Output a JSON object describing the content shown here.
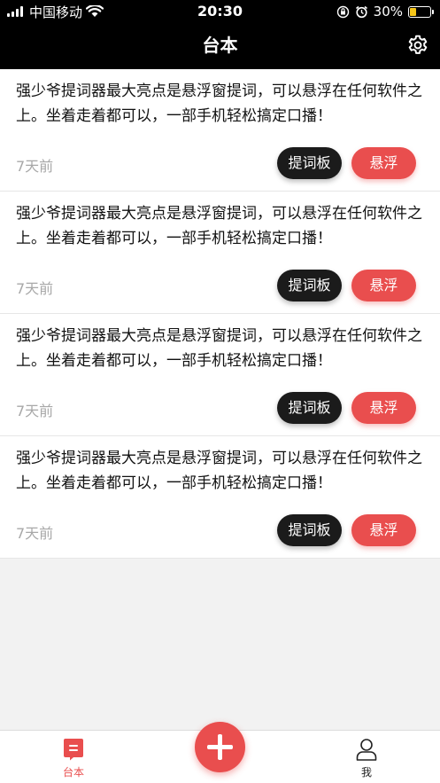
{
  "status_bar": {
    "carrier": "中国移动",
    "time": "20:30",
    "battery_percent": "30%",
    "battery_level": 0.3,
    "icons": [
      "signal-icon",
      "wifi-icon",
      "orientation-lock-icon",
      "alarm-icon",
      "battery-icon"
    ]
  },
  "header": {
    "title": "台本",
    "settings_icon": "gear-icon"
  },
  "scripts": [
    {
      "text": "强少爷提词器最大亮点是悬浮窗提词，可以悬浮在任何软件之上。坐着走着都可以，一部手机轻松搞定口播！",
      "time": "7天前",
      "prompter_label": "提词板",
      "float_label": "悬浮"
    },
    {
      "text": "强少爷提词器最大亮点是悬浮窗提词，可以悬浮在任何软件之上。坐着走着都可以，一部手机轻松搞定口播！",
      "time": "7天前",
      "prompter_label": "提词板",
      "float_label": "悬浮"
    },
    {
      "text": "强少爷提词器最大亮点是悬浮窗提词，可以悬浮在任何软件之上。坐着走着都可以，一部手机轻松搞定口播！",
      "time": "7天前",
      "prompter_label": "提词板",
      "float_label": "悬浮"
    },
    {
      "text": "强少爷提词器最大亮点是悬浮窗提词，可以悬浮在任何软件之上。坐着走着都可以，一部手机轻松搞定口播！",
      "time": "7天前",
      "prompter_label": "提词板",
      "float_label": "悬浮"
    }
  ],
  "tabbar": {
    "scripts_label": "台本",
    "me_label": "我",
    "add_icon": "plus-icon",
    "accent_color": "#e94e4e"
  }
}
